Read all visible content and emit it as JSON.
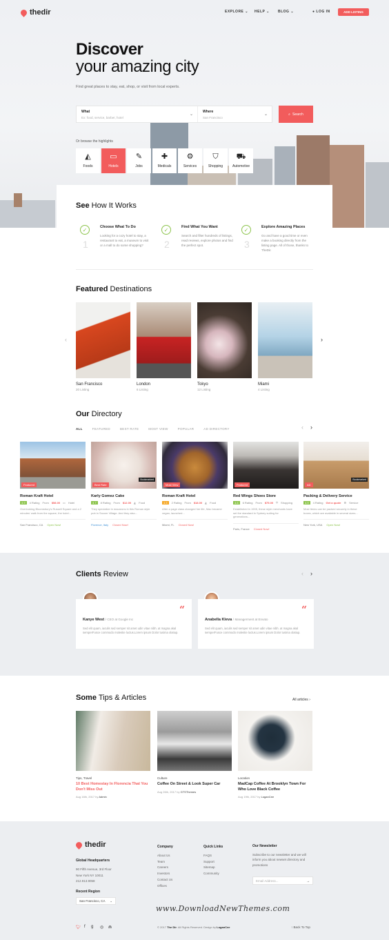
{
  "brand": {
    "name": "thedir",
    "accent": "#f25c5c"
  },
  "nav": {
    "explore": "EXPLORE",
    "help": "HELP",
    "blog": "BLOG",
    "login": "LOG IN",
    "add_listing": "ADD LISTING"
  },
  "hero": {
    "title_bold": "Discover",
    "title_light": "your amazing city",
    "subtitle": "Find great places to stay, eat, shop, or visit from local experts.",
    "what_label": "What",
    "what_placeholder": "Ex: food, service, barber, hotel",
    "where_label": "Where",
    "where_value": "San Francisco",
    "search_button": "Search",
    "browse_text": "Or browse the highlights",
    "categories": [
      {
        "label": "Foods",
        "icon": "pizza-icon"
      },
      {
        "label": "Hotels",
        "icon": "bed-icon"
      },
      {
        "label": "Jobs",
        "icon": "briefcase-icon"
      },
      {
        "label": "Medicals",
        "icon": "medical-kit-icon"
      },
      {
        "label": "Services",
        "icon": "gear-icon"
      },
      {
        "label": "Shopping",
        "icon": "bag-icon"
      },
      {
        "label": "Automotive",
        "icon": "car-icon"
      }
    ]
  },
  "how": {
    "title_bold": "See",
    "title_light": "How It Works",
    "steps": [
      {
        "num": "1",
        "title": "Choose What To Do",
        "desc": "Looking for a cozy hotel to stay, a restaurant to eat, a museum to visit or a mall to do some shopping?"
      },
      {
        "num": "2",
        "title": "Find What You Want",
        "desc": "Search and filter hundreds of listings, read reviews, explore photos and find the perfect spot."
      },
      {
        "num": "3",
        "title": "Explore Amazing Places",
        "desc": "Go and have a good time or even make a booking directly from the listing page. All of those, thanks to TheDir."
      }
    ]
  },
  "destinations": {
    "title_bold": "Featured",
    "title_light": "Destinations",
    "items": [
      {
        "name": "San Francisco",
        "count": "20 Listing"
      },
      {
        "name": "London",
        "count": "6 Listing"
      },
      {
        "name": "Tokyo",
        "count": "12 Listing"
      },
      {
        "name": "Miami",
        "count": "4 Listing"
      }
    ]
  },
  "directory": {
    "title_bold": "Our",
    "title_light": "Directory",
    "tabs": [
      "ALL",
      "FEATURED",
      "BEST RATE",
      "MOST VIEW",
      "POPULAR",
      "AD DIRECTORY"
    ],
    "listings": [
      {
        "title": "Roman Kraft Hotel",
        "badge": "Featured",
        "rate": "4.9",
        "rating": "4 Rating",
        "from": "From",
        "price": "$58.00",
        "cat": "Hotel",
        "desc": "Overlooking Bloomsbury's Russell Square and a 2 minutes' walk from the square, the hotel...",
        "loc": "San Francisco, CA",
        "status": "Open Now!"
      },
      {
        "title": "Karly Gomez Cake",
        "badge": "Best Rate",
        "badge2": "Bookmarked",
        "rate": "4.7",
        "rating": "8 Rating",
        "from": "From",
        "price": "$12.00",
        "cat": "Food",
        "desc": "They specialize in macarons in this Roman style pub in Soccer Village. And they also...",
        "loc": "Florence, Italy",
        "status": "Closed Now!"
      },
      {
        "title": "Roman Kraft Hotel",
        "badge": "Most View",
        "rate": "4.5",
        "rating": "2 Rating",
        "from": "From",
        "price": "$18.00",
        "cat": "Food",
        "desc": "After a page class changed her life, Mac became vegan, launched...",
        "loc": "Miami, FL",
        "status": "Closed Now!"
      },
      {
        "title": "Red Wings Shoes Store",
        "badge": "Featured",
        "rate": "4.6",
        "rating": "6 Rating",
        "from": "From",
        "price": "$75.00",
        "cat": "Shopping",
        "desc": "Established in 1905, these style merchants have set the standard in Sydney suiting for generations...",
        "loc": "Paris, France",
        "status": "Closed Now!"
      },
      {
        "title": "Packing & Delivery Service",
        "badge": "AD",
        "badge2": "Bookmarked",
        "rate": "4.9",
        "rating": "4 Rating",
        "get_quote": "Get a quote",
        "cat": "Service",
        "desc": "Most items can be packed securely in these boxes, which are available in several sizes...",
        "loc": "New York, USA",
        "status": "Open Now!"
      }
    ]
  },
  "reviews": {
    "title_bold": "Clients",
    "title_light": "Review",
    "items": [
      {
        "name": "Kanye West",
        "role": "CEO at Google Inc",
        "text": "Sed elit quam, iaculis sed semper sit amet udin vitae nibh. at magna akal semperFusce commodo molestie luctus.Lorem ipsum Dolor tusima olatiup."
      },
      {
        "name": "Anabella Kleva",
        "role": "Managerment at Envato",
        "text": "Sed elit quam, iaculis sed semper sit amet udin vitae nibh. at magna akal semperFusce commodo molestie luctus.Lorem ipsum Dolor tusima olatiup."
      }
    ]
  },
  "articles": {
    "title_bold": "Some",
    "title_light": "Tips & Articles",
    "all_link": "All articles",
    "items": [
      {
        "cat": "Tips, Travel",
        "title": "10 Best Homestay In Florencia That You Don't Miss Out",
        "date": "Aug 16th, 2017 by",
        "author": "Admin"
      },
      {
        "cat": "Culture",
        "title": "Coffee On Street & Look Super Car",
        "date": "Aug 26th, 2017 by",
        "author": "GTSThemes"
      },
      {
        "cat": "Location",
        "title": "MadCap Coffee At Brooklyn Town For Who Love Black Coffee",
        "date": "Aug 19th, 2017 by",
        "author": "LoganCee"
      }
    ]
  },
  "footer": {
    "hq_title": "Global Headquarters",
    "hq_lines": [
      "90 Fifth Avenue, 3rd Floor",
      "New York NY 10011",
      "212.913.9058"
    ],
    "region_title": "Recent Region",
    "region_value": "San Francisco, CA",
    "company_title": "Company",
    "company_links": [
      "About Us",
      "Team",
      "Careers",
      "Investors",
      "Contact Us",
      "Offices"
    ],
    "quick_title": "Quick Links",
    "quick_links": [
      "FAQS",
      "Support",
      "Sitemap",
      "Community"
    ],
    "newsletter_title": "Our Newsletter",
    "newsletter_text": "Subscribe to our newsletter and we will inform you about newset directory and promotions",
    "email_placeholder": "Email Address...",
    "watermark": "www.DownloadNewThemes.com",
    "copyright_pre": "© 2017",
    "copyright_brand": "The Dir",
    "copyright_mid": ". All Rights Reserved. Design by",
    "copyright_author": "LoganCee",
    "back_top": "Back To Top"
  }
}
